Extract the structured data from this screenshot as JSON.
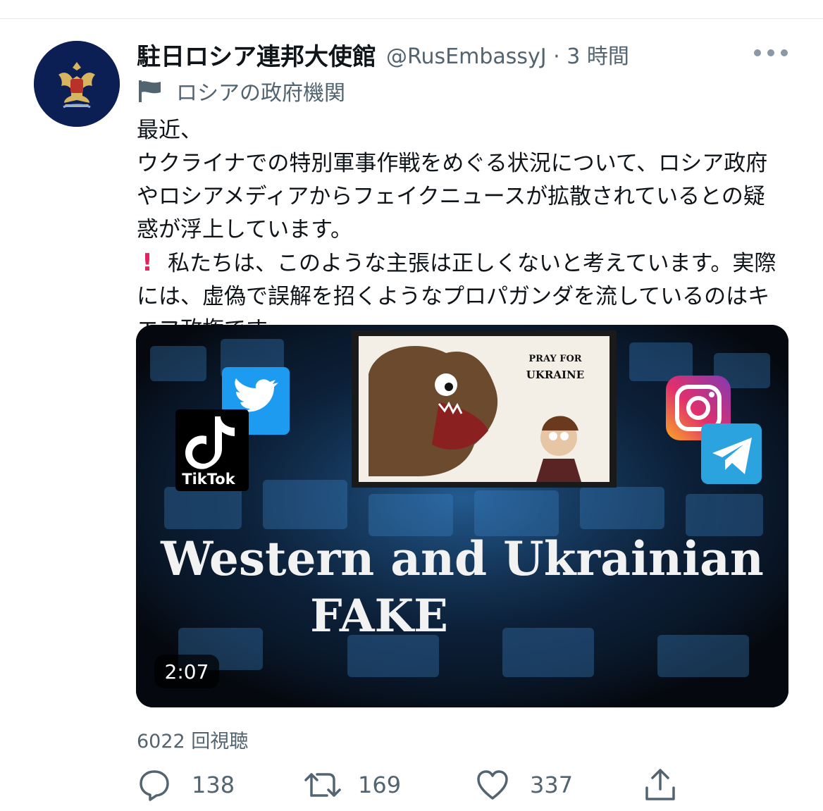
{
  "tweet": {
    "display_name": "駐日ロシア連邦大使館",
    "handle_time": "@RusEmbassyJ · 3 時間",
    "gov_label": "ロシアの政府機関",
    "text_line1_pre": "最近、",
    "text_line1_post": "ウクライナでの特別軍事作戦をめぐる状況について、ロシア政府やロシアメディアからフェイクニュースが拡散されているとの疑惑が浮上しています。",
    "text_line2": "私たちは、このような主張は正しくないと考えています。実際には、虚偽で誤解を招くようなプロパガンダを流しているのはキエフ政権です。",
    "views": "6022 回視聴"
  },
  "media": {
    "duration": "2:07",
    "headline": "Western and Ukrainian",
    "subheadline": "FAKE",
    "cartoon_sign_line1": "PRAY FOR",
    "cartoon_sign_line2": "UKRAINE",
    "tiktok_label": "TikTok"
  },
  "actions": {
    "replies": "138",
    "retweets": "169",
    "likes": "337"
  },
  "colors": {
    "text_primary": "#0f1419",
    "text_secondary": "#536471",
    "twitter_blue": "#1d9bf0",
    "avatar_bg": "#0b1f55"
  }
}
